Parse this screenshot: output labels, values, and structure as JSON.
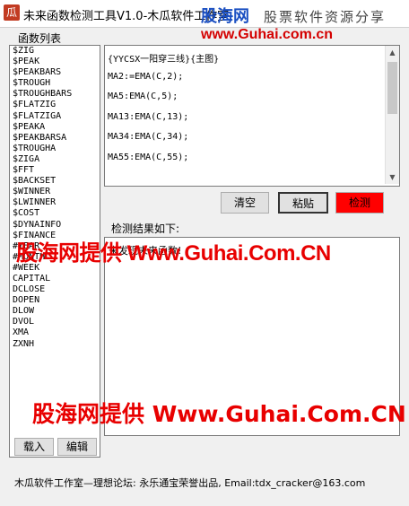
{
  "window": {
    "icon_glyph": "瓜",
    "title": "未来函数检测工具V1.0-木瓜软件工作室"
  },
  "brand": {
    "logo": "股海网",
    "slogan": "股票软件资源分享",
    "url": "www.Guhai.com.cn"
  },
  "function_list": {
    "label": "函数列表",
    "items": [
      "$ZIG",
      "$PEAK",
      "$PEAKBARS",
      "$TROUGH",
      "$TROUGHBARS",
      "$FLATZIG",
      "$FLATZIGA",
      "$PEAKA",
      "$PEAKBARSA",
      "$TROUGHA",
      "$ZIGA",
      "$FFT",
      "$BACKSET",
      "$WINNER",
      "$LWINNER",
      "$COST",
      "$DYNAINFO",
      "$FINANCE",
      "#YEAR",
      "#MONTH",
      "#WEEK",
      "CAPITAL",
      "DCLOSE",
      "DOPEN",
      "DLOW",
      "DVOL",
      "XMA",
      "ZXNH"
    ],
    "load_button": "载入",
    "edit_button": "编辑"
  },
  "formula": {
    "lines": [
      "{YYCSX一阳穿三线}{主图}",
      "MA2:=EMA(C,2);",
      "MA5:EMA(C,5);",
      "MA13:EMA(C,13);",
      "MA34:EMA(C,34);",
      "MA55:EMA(C,55);"
    ]
  },
  "actions": {
    "clear": "清空",
    "paste": "粘贴",
    "detect": "检测"
  },
  "result": {
    "label": "检测结果如下:",
    "text": "未发现未来函数!"
  },
  "status": "木瓜软件工作室—理想论坛: 永乐通宝荣誉出品, Email:tdx_cracker@163.com",
  "watermark": {
    "line1": "股海网提供 Www.Guhai.Com.CN",
    "line2": "股海网提供 Www.Guhai.Com.CN"
  },
  "colors": {
    "detect_button": "#ff0000",
    "watermark": "#e80000"
  }
}
